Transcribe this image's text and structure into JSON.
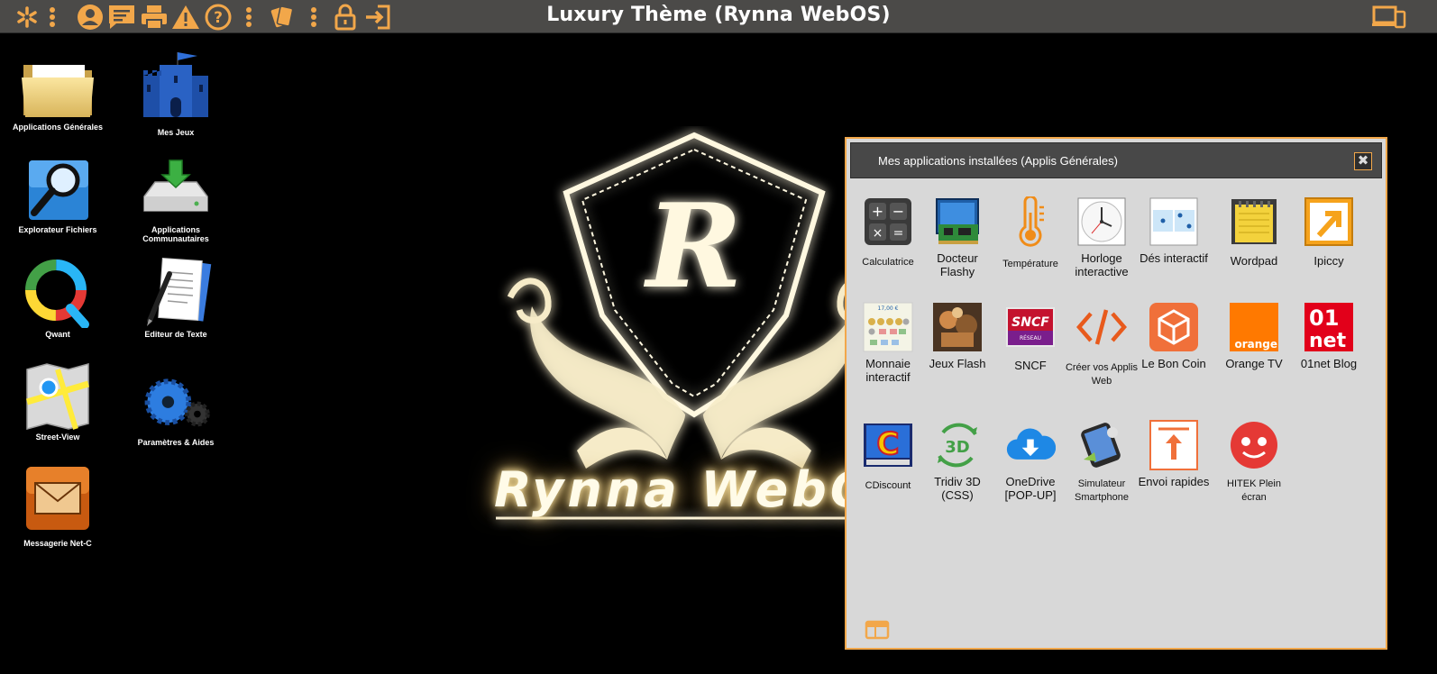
{
  "title": "Luxury Thème (Rynna WebOS)",
  "accent": "#f2a74a",
  "topbar": {
    "left_icons": [
      "asterisk-icon",
      "more-vertical-icon",
      "user-icon",
      "comment-icon",
      "print-icon",
      "warning-icon",
      "help-icon",
      "more-vertical-icon",
      "cards-icon",
      "more-vertical-icon",
      "lock-icon",
      "sign-in-icon"
    ],
    "right_icon": "devices-icon"
  },
  "desktop": [
    {
      "label": "Applications Générales",
      "icon": "folder-icon"
    },
    {
      "label": "Mes Jeux",
      "icon": "castle-icon"
    },
    {
      "label": "Explorateur Fichiers",
      "icon": "magnifier-icon"
    },
    {
      "label": "Applications Communautaires",
      "icon": "download-drive-icon"
    },
    {
      "label": "Qwant",
      "icon": "qwant-icon"
    },
    {
      "label": "Editeur de Texte",
      "icon": "text-editor-icon"
    },
    {
      "label": "Street-View",
      "icon": "map-icon"
    },
    {
      "label": "Paramètres & Aides",
      "icon": "gear-icon"
    },
    {
      "label": "Messagerie Net-C",
      "icon": "envelope-icon"
    }
  ],
  "logo": {
    "text": "Rynna WebOS",
    "letter": "R"
  },
  "window": {
    "title": "Mes applications installées (Applis Générales)",
    "close_label": "✖",
    "apps": [
      {
        "label": "Calculatrice",
        "icon": "calculator-icon"
      },
      {
        "label": "Docteur Flashy",
        "icon": "circuit-board-icon"
      },
      {
        "label": "Température",
        "icon": "thermometer-icon"
      },
      {
        "label": "Horloge interactive",
        "icon": "clock-icon"
      },
      {
        "label": "Dés interactif",
        "icon": "dice-icon"
      },
      {
        "label": "Wordpad",
        "icon": "notepad-icon"
      },
      {
        "label": "Ipiccy",
        "icon": "ipiccy-icon"
      },
      {
        "label": "Monnaie interactif",
        "icon": "coins-icon"
      },
      {
        "label": "Jeux Flash",
        "icon": "games-photo-icon"
      },
      {
        "label": "SNCF",
        "icon": "sncf-icon"
      },
      {
        "label": "Créer vos Applis Web",
        "icon": "code-icon"
      },
      {
        "label": "Le Bon Coin",
        "icon": "box-icon"
      },
      {
        "label": "Orange TV",
        "icon": "orange-icon",
        "badge": "orange"
      },
      {
        "label": "01net Blog",
        "icon": "01net-icon",
        "badge1": "01",
        "badge2": "net"
      },
      {
        "label": "CDiscount",
        "icon": "cdiscount-icon",
        "badge": "C"
      },
      {
        "label": "Tridiv 3D (CSS)",
        "icon": "3d-icon",
        "badge": "3D"
      },
      {
        "label": "OneDrive [POP-UP]",
        "icon": "cloud-download-icon"
      },
      {
        "label": "Simulateur Smartphone",
        "icon": "smartphone-icon"
      },
      {
        "label": "Envoi rapides",
        "icon": "upload-icon"
      },
      {
        "label": "HITEK Plein écran",
        "icon": "hitek-icon"
      }
    ],
    "footer_icon": "window-layout-icon"
  }
}
